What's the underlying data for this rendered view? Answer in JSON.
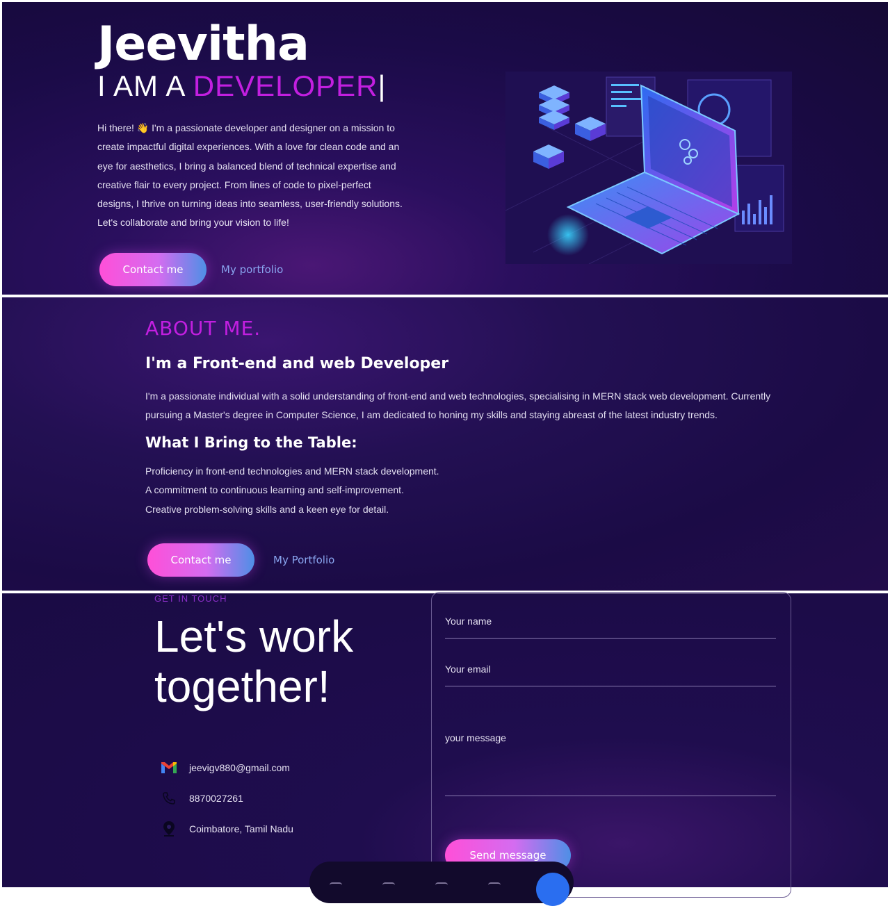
{
  "hero": {
    "name": "Jeevitha",
    "role_prefix": "I AM A ",
    "role_word": "DEVELOPER",
    "caret": "|",
    "intro": "Hi there! 👋 I'm a passionate developer and designer on a mission to create impactful digital experiences. With a love for clean code and an eye for aesthetics, I bring a balanced blend of technical expertise and creative flair to every project. From lines of code to pixel-perfect designs, I thrive on turning ideas into seamless, user-friendly solutions. Let's collaborate and bring your vision to life!",
    "contact_label": "Contact me",
    "portfolio_label": "My portfolio",
    "illustration_icon": "isometric-laptop-illustration"
  },
  "about": {
    "heading": "ABOUT ME.",
    "title": "I'm a Front-end and web Developer",
    "text": "I'm a passionate individual with a solid understanding of front-end and web technologies, specialising in MERN stack web development. Currently pursuing a Master's degree in Computer Science, I am dedicated to honing my skills and staying abreast of the latest industry trends.",
    "subheading": "What I Bring to the Table:",
    "points": [
      "Proficiency in front-end technologies and MERN stack development.",
      "A commitment to continuous learning and self-improvement.",
      "Creative problem-solving skills and a keen eye for detail."
    ],
    "contact_label": "Contact me",
    "portfolio_label": "My Portfolio"
  },
  "contact": {
    "kicker": "GET IN TOUCH",
    "title": "Let's work together!",
    "email": "jeevigv880@gmail.com",
    "phone": "8870027261",
    "location": "Coimbatore, Tamil Nadu",
    "form": {
      "name_placeholder": "Your name",
      "email_placeholder": "Your email",
      "message_placeholder": "your message",
      "send_label": "Send message"
    },
    "icons": [
      "gmail-icon",
      "phone-icon",
      "location-pin-icon"
    ]
  },
  "colors": {
    "accent": "#c21fe0",
    "pink": "#ff4fd8",
    "blue": "#4e8fe6",
    "bg": "#1c0c4c"
  }
}
